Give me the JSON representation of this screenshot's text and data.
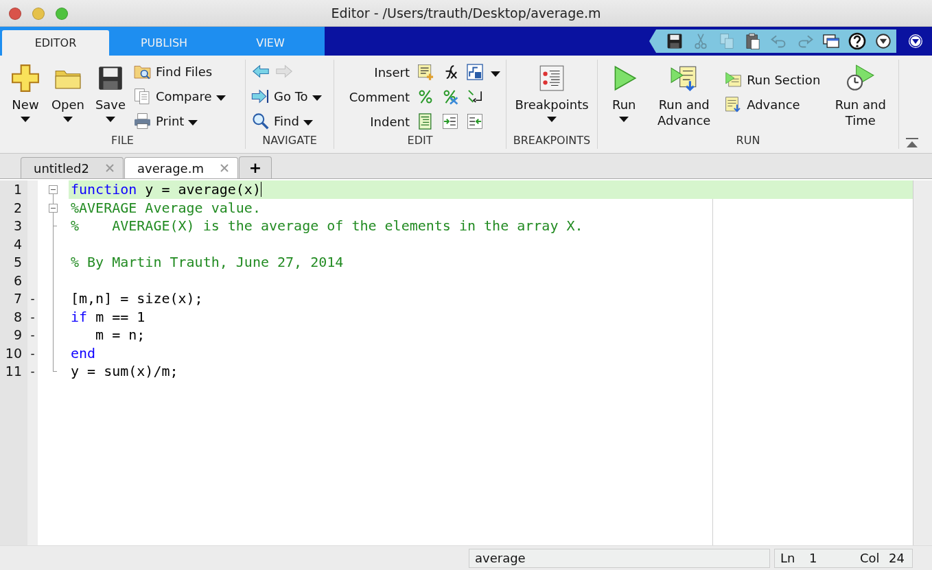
{
  "window": {
    "title": "Editor - /Users/trauth/Desktop/average.m"
  },
  "ribbon_tabs": [
    {
      "label": "EDITOR",
      "selected": true
    },
    {
      "label": "PUBLISH",
      "selected": false
    },
    {
      "label": "VIEW",
      "selected": false
    }
  ],
  "quick_access": [
    {
      "disabled": false
    },
    {
      "disabled": true
    },
    {
      "disabled": true
    },
    {
      "disabled": false
    },
    {
      "disabled": true
    },
    {
      "disabled": true
    },
    {
      "disabled": false
    },
    {
      "disabled": false
    },
    {
      "disabled": false
    }
  ],
  "ribbon_groups": [
    {
      "label": "FILE",
      "items": [
        {
          "kind": "large",
          "label": "New",
          "dropdown": true
        },
        {
          "kind": "large",
          "label": "Open",
          "dropdown": true
        },
        {
          "kind": "large",
          "label": "Save",
          "dropdown": true
        },
        {
          "kind": "small",
          "label": "Find Files",
          "dropdown": false
        },
        {
          "kind": "small",
          "label": "Compare",
          "dropdown": true
        },
        {
          "kind": "small",
          "label": "Print",
          "dropdown": true
        }
      ]
    },
    {
      "label": "NAVIGATE",
      "items": [
        {
          "kind": "nav",
          "back_disabled": false,
          "forward_disabled": true
        },
        {
          "kind": "small",
          "label": "Go To",
          "dropdown": true
        },
        {
          "kind": "small",
          "label": "Find",
          "dropdown": true
        }
      ]
    },
    {
      "label": "EDIT",
      "items": [
        {
          "kind": "row",
          "label": "Insert",
          "dropdown": true
        },
        {
          "kind": "row",
          "label": "Comment",
          "dropdown": false
        },
        {
          "kind": "row",
          "label": "Indent",
          "dropdown": false
        }
      ]
    },
    {
      "label": "BREAKPOINTS",
      "items": [
        {
          "kind": "large",
          "label": "Breakpoints",
          "dropdown": true
        }
      ]
    },
    {
      "label": "RUN",
      "items": [
        {
          "kind": "large",
          "label": "Run",
          "dropdown": true
        },
        {
          "kind": "large",
          "label": "Run and Advance",
          "dropdown": false
        },
        {
          "kind": "small",
          "label": "Run Section",
          "dropdown": false
        },
        {
          "kind": "small",
          "label": "Advance",
          "dropdown": false
        },
        {
          "kind": "large",
          "label": "Run and Time",
          "dropdown": false
        }
      ]
    }
  ],
  "doc_tabs": [
    {
      "label": "untitled2",
      "selected": false
    },
    {
      "label": "average.m",
      "selected": true
    }
  ],
  "new_tab": "+",
  "lines": [
    {
      "number": "1",
      "foldable": true,
      "current": true,
      "cursor": true,
      "tokens": [
        {
          "kind": "keyword",
          "text": "function"
        },
        {
          "kind": "plain",
          "text": " y = average(x)"
        }
      ]
    },
    {
      "number": "2",
      "foldable": true,
      "current": false,
      "cursor": false,
      "tokens": [
        {
          "kind": "comment",
          "text": "%AVERAGE Average value."
        }
      ]
    },
    {
      "number": "3",
      "foldable": false,
      "current": false,
      "cursor": false,
      "tokens": [
        {
          "kind": "comment",
          "text": "%    AVERAGE(X) is the average of the elements in the array X."
        }
      ]
    },
    {
      "number": "4",
      "foldable": false,
      "current": false,
      "cursor": false
    },
    {
      "number": "5",
      "foldable": false,
      "current": false,
      "cursor": false,
      "tokens": [
        {
          "kind": "comment",
          "text": "% By Martin Trauth, June 27, 2014"
        }
      ]
    },
    {
      "number": "6",
      "foldable": false,
      "current": false,
      "cursor": false
    },
    {
      "number": "7",
      "marker": "-",
      "foldable": false,
      "current": false,
      "cursor": false,
      "tokens": [
        {
          "kind": "plain",
          "text": "[m,n] = size(x);"
        }
      ]
    },
    {
      "number": "8",
      "marker": "-",
      "foldable": false,
      "current": false,
      "cursor": false,
      "tokens": [
        {
          "kind": "keyword",
          "text": "if"
        },
        {
          "kind": "plain",
          "text": " m == 1"
        }
      ]
    },
    {
      "number": "9",
      "marker": "-",
      "foldable": false,
      "current": false,
      "cursor": false,
      "tokens": [
        {
          "kind": "plain",
          "text": "   m = n;"
        }
      ]
    },
    {
      "number": "10",
      "marker": "-",
      "foldable": false,
      "current": false,
      "cursor": false,
      "tokens": [
        {
          "kind": "keyword",
          "text": "end"
        }
      ]
    },
    {
      "number": "11",
      "marker": "-",
      "foldable": false,
      "current": false,
      "cursor": false,
      "tokens": [
        {
          "kind": "plain",
          "text": "y = sum(x)/m;"
        }
      ]
    }
  ],
  "status_bar": {
    "function": "average",
    "line_label": "Ln",
    "line": "1",
    "col_label": "Col",
    "col": "24"
  }
}
